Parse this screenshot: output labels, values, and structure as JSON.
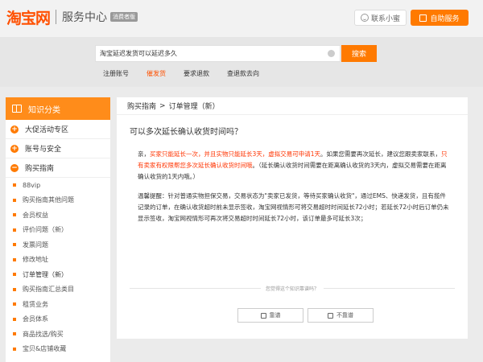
{
  "header": {
    "logo": "淘宝网",
    "title": "服务中心",
    "tag": "消费者版",
    "contact_label": "联系小蜜",
    "self_service_label": "自助服务"
  },
  "search": {
    "value": "淘宝延迟发货可以延迟多久",
    "button_label": "搜索"
  },
  "quick_links": [
    "注册账号",
    "催发货",
    "要求退款",
    "查退款去向"
  ],
  "sidebar": {
    "title": "知识分类",
    "categories": [
      {
        "label": "大促活动专区",
        "symbol": "+"
      },
      {
        "label": "账号与安全",
        "symbol": "+"
      },
      {
        "label": "购买指南",
        "symbol": "−"
      }
    ],
    "sub_items": [
      "88vip",
      "购买指南其他问题",
      "会员权益",
      "评价问题（新）",
      "发票问题",
      "修改地址",
      "订单管理（新）",
      "购买指南汇总类目",
      "租赁业务",
      "会员体系",
      "商品找选/购买",
      "宝贝&店铺收藏"
    ]
  },
  "breadcrumb": {
    "parent": "购买指南",
    "separator": ">",
    "current": "订单管理（新）"
  },
  "question": {
    "title": "可以多次延长确认收货时间吗？"
  },
  "answer": {
    "p1_a": "亲，",
    "p1_b": "买家只能延长一次，并且实物只能延长3天，虚拟交易可申请1天",
    "p1_c": "。如果您需要再次延长，建议您跟卖家联系，",
    "p1_d": "只有卖家有权限帮您多次延长确认收货时间哦",
    "p1_e": "。（延长确认收货时间需要在距离确认收货的3天内，虚拟交易需要在距离确认收货的1天内哦。）",
    "p2": "温馨提醒：针对普通实物担保交易，交易状态为\"卖家已发货，等待买家确认收货\"，通过EMS、快递发货，且有揽件记录的订单，在确认收货超时前未显示签收，淘宝网视情形可将交易超时时间延长72小时；若延长72小时后订单仍未显示签收，淘宝网视情形可再次将交易超时时间延长72小时，该订单最多可延长3次；"
  },
  "feedback": {
    "question": "您觉得这个知识靠谱吗？",
    "up": "靠谱",
    "down": "不靠谱"
  },
  "colors": {
    "accent": "#ff7a00",
    "brand": "#ff5000",
    "highlight": "#ff3300"
  },
  "icons": {
    "contact": "smile-icon",
    "self_service": "square-icon",
    "sidebar": "book-icon",
    "vote_up": "thumbs-up-icon",
    "vote_down": "thumbs-down-icon",
    "clear": "clear-icon"
  }
}
